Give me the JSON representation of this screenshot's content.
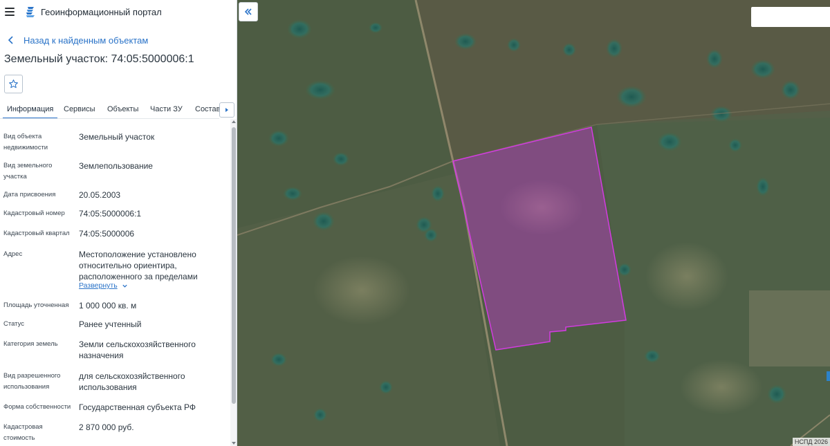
{
  "app": {
    "title": "Геоинформационный портал"
  },
  "nav": {
    "back_label": "Назад к найденным объектам"
  },
  "object": {
    "title": "Земельный участок: 74:05:5000006:1"
  },
  "tabs": [
    {
      "label": "Информация",
      "active": true
    },
    {
      "label": "Сервисы",
      "active": false
    },
    {
      "label": "Объекты",
      "active": false
    },
    {
      "label": "Части ЗУ",
      "active": false
    },
    {
      "label": "Состав",
      "active": false
    }
  ],
  "info": {
    "type": {
      "label": "Вид объекта недвижимости",
      "value": "Земельный участок"
    },
    "land_kind": {
      "label": "Вид земельного участка",
      "value": "Землепользование"
    },
    "assigned_date": {
      "label": "Дата присвоения",
      "value": "20.05.2003"
    },
    "cad_number": {
      "label": "Кадастровый номер",
      "value": "74:05:5000006:1"
    },
    "cad_quarter": {
      "label": "Кадастровый квартал",
      "value": "74:05:5000006"
    },
    "address": {
      "label": "Адрес",
      "value": "Местоположение установлено относительно ориентира, расположенного за пределами",
      "expand_label": "Развернуть"
    },
    "area": {
      "label": "Площадь уточненная",
      "value": "1 000 000 кв. м"
    },
    "status": {
      "label": "Статус",
      "value": "Ранее учтенный"
    },
    "category": {
      "label": "Категория земель",
      "value": "Земли сельскохозяйственного назначения"
    },
    "permitted_use": {
      "label": "Вид разрешенного использования",
      "value": "для сельскохозяйственного использования"
    },
    "ownership": {
      "label": "Форма собственности",
      "value": "Государственная субъекта РФ"
    },
    "cad_value": {
      "label": "Кадастровая стоимость",
      "value": "2 870 000 руб."
    }
  },
  "map": {
    "copyright": "НСПД 2026",
    "parcel_color": "#c837d6",
    "accent": "#2a73c8"
  },
  "icons": {
    "menu": "hamburger-icon",
    "logo": "portal-logo-icon",
    "back": "chevron-left-icon",
    "favorite": "star-icon",
    "tabs_next": "caret-right-icon",
    "collapse": "double-chevron-left-icon",
    "expand": "chevron-down-icon"
  }
}
